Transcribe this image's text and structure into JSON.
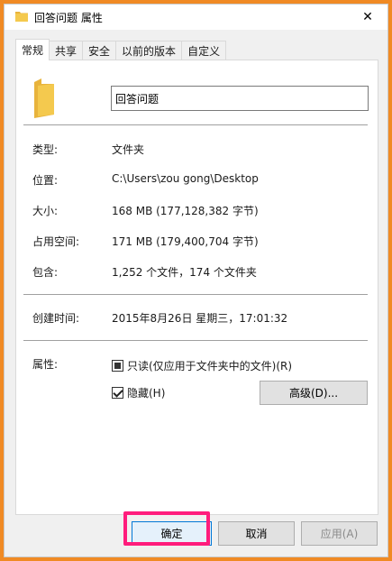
{
  "window": {
    "title": "回答问题 属性",
    "close_glyph": "✕"
  },
  "tabs": [
    {
      "label": "常规",
      "active": true
    },
    {
      "label": "共享",
      "active": false
    },
    {
      "label": "安全",
      "active": false
    },
    {
      "label": "以前的版本",
      "active": false
    },
    {
      "label": "自定义",
      "active": false
    }
  ],
  "general": {
    "name_value": "回答问题",
    "type_label": "类型:",
    "type_value": "文件夹",
    "location_label": "位置:",
    "location_value": "C:\\Users\\zou gong\\Desktop",
    "size_label": "大小:",
    "size_value": "168 MB (177,128,382 字节)",
    "size_on_disk_label": "占用空间:",
    "size_on_disk_value": "171 MB (179,400,704 字节)",
    "contains_label": "包含:",
    "contains_value": "1,252 个文件，174 个文件夹",
    "created_label": "创建时间:",
    "created_value": "2015年8月26日 星期三，17:01:32",
    "attributes_label": "属性:",
    "readonly_label": "只读(仅应用于文件夹中的文件)(R)",
    "readonly_state": "indeterminate",
    "hidden_label": "隐藏(H)",
    "hidden_state": "checked",
    "advanced_label": "高级(D)..."
  },
  "footer": {
    "ok_label": "确定",
    "cancel_label": "取消",
    "apply_label": "应用(A)"
  },
  "colors": {
    "background_border": "#f08a24",
    "highlight": "#ff1c7c",
    "folder": "#f4c94e"
  }
}
